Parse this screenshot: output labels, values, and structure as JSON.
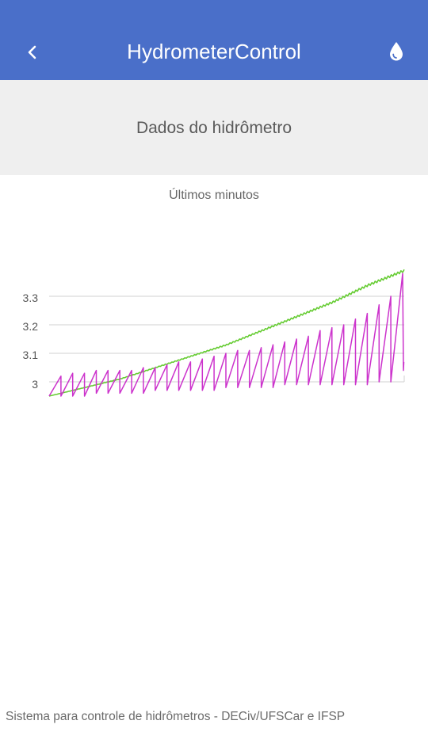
{
  "app_bar": {
    "title": "HydrometerControl",
    "back_icon": "chevron-left-icon",
    "action_icon": "water-drop-icon",
    "color": "#4a6fc9"
  },
  "section": {
    "title": "Dados do hidrômetro"
  },
  "chart_data": {
    "type": "line",
    "title": "Últimos minutos",
    "xlabel": "",
    "ylabel": "",
    "ylim": [
      2.95,
      3.4
    ],
    "yticks": [
      "3",
      "3.1",
      "3.2",
      "3.3"
    ],
    "ytick_values": [
      3.0,
      3.1,
      3.2,
      3.3
    ],
    "grid": true,
    "legend": "none",
    "series": [
      {
        "color": "#66cc33",
        "shape": "rising-curve",
        "x": [
          0,
          10,
          20,
          30,
          40,
          50,
          60,
          70,
          80,
          90,
          100
        ],
        "values": [
          2.95,
          2.98,
          3.01,
          3.05,
          3.09,
          3.13,
          3.18,
          3.23,
          3.28,
          3.34,
          3.39
        ]
      },
      {
        "color": "#cc33cc",
        "shape": "sawtooth",
        "lows": [
          2.95,
          2.95,
          2.95,
          2.95,
          2.96,
          2.96,
          2.96,
          2.96,
          2.96,
          2.97,
          2.97,
          2.97,
          2.97,
          2.97,
          2.97,
          2.98,
          2.98,
          2.98,
          2.98,
          2.98,
          2.99,
          2.99,
          2.99,
          2.99,
          2.99,
          2.99,
          2.99,
          2.99,
          3.0,
          3.0
        ],
        "peaks": [
          3.02,
          3.03,
          3.03,
          3.04,
          3.04,
          3.04,
          3.04,
          3.05,
          3.05,
          3.06,
          3.07,
          3.07,
          3.08,
          3.09,
          3.1,
          3.11,
          3.11,
          3.12,
          3.13,
          3.14,
          3.15,
          3.16,
          3.18,
          3.19,
          3.2,
          3.22,
          3.24,
          3.27,
          3.3,
          3.38
        ]
      }
    ]
  },
  "footer": {
    "text": "Sistema para controle de hidrômetros - DECiv/UFSCar e IFSP"
  }
}
